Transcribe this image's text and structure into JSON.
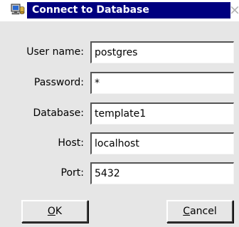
{
  "window": {
    "title": "Connect to Database",
    "close_glyph": "×"
  },
  "form": {
    "fields": [
      {
        "label": "User name:",
        "value": "postgres"
      },
      {
        "label": "Password:",
        "value": "*"
      },
      {
        "label": "Database:",
        "value": "template1"
      },
      {
        "label": "Host:",
        "value": "localhost"
      },
      {
        "label": "Port:",
        "value": "5432"
      }
    ]
  },
  "buttons": {
    "ok": {
      "mnemonic": "O",
      "rest": "K"
    },
    "cancel": {
      "mnemonic": "C",
      "rest": "ancel"
    }
  },
  "colors": {
    "titlebar_active": "#00007f",
    "title_text": "#ffffff",
    "dialog_background": "#e6e6e6",
    "field_background": "#ffffff"
  },
  "icons": {
    "title": "database-connection-icon",
    "close": "close-icon"
  }
}
